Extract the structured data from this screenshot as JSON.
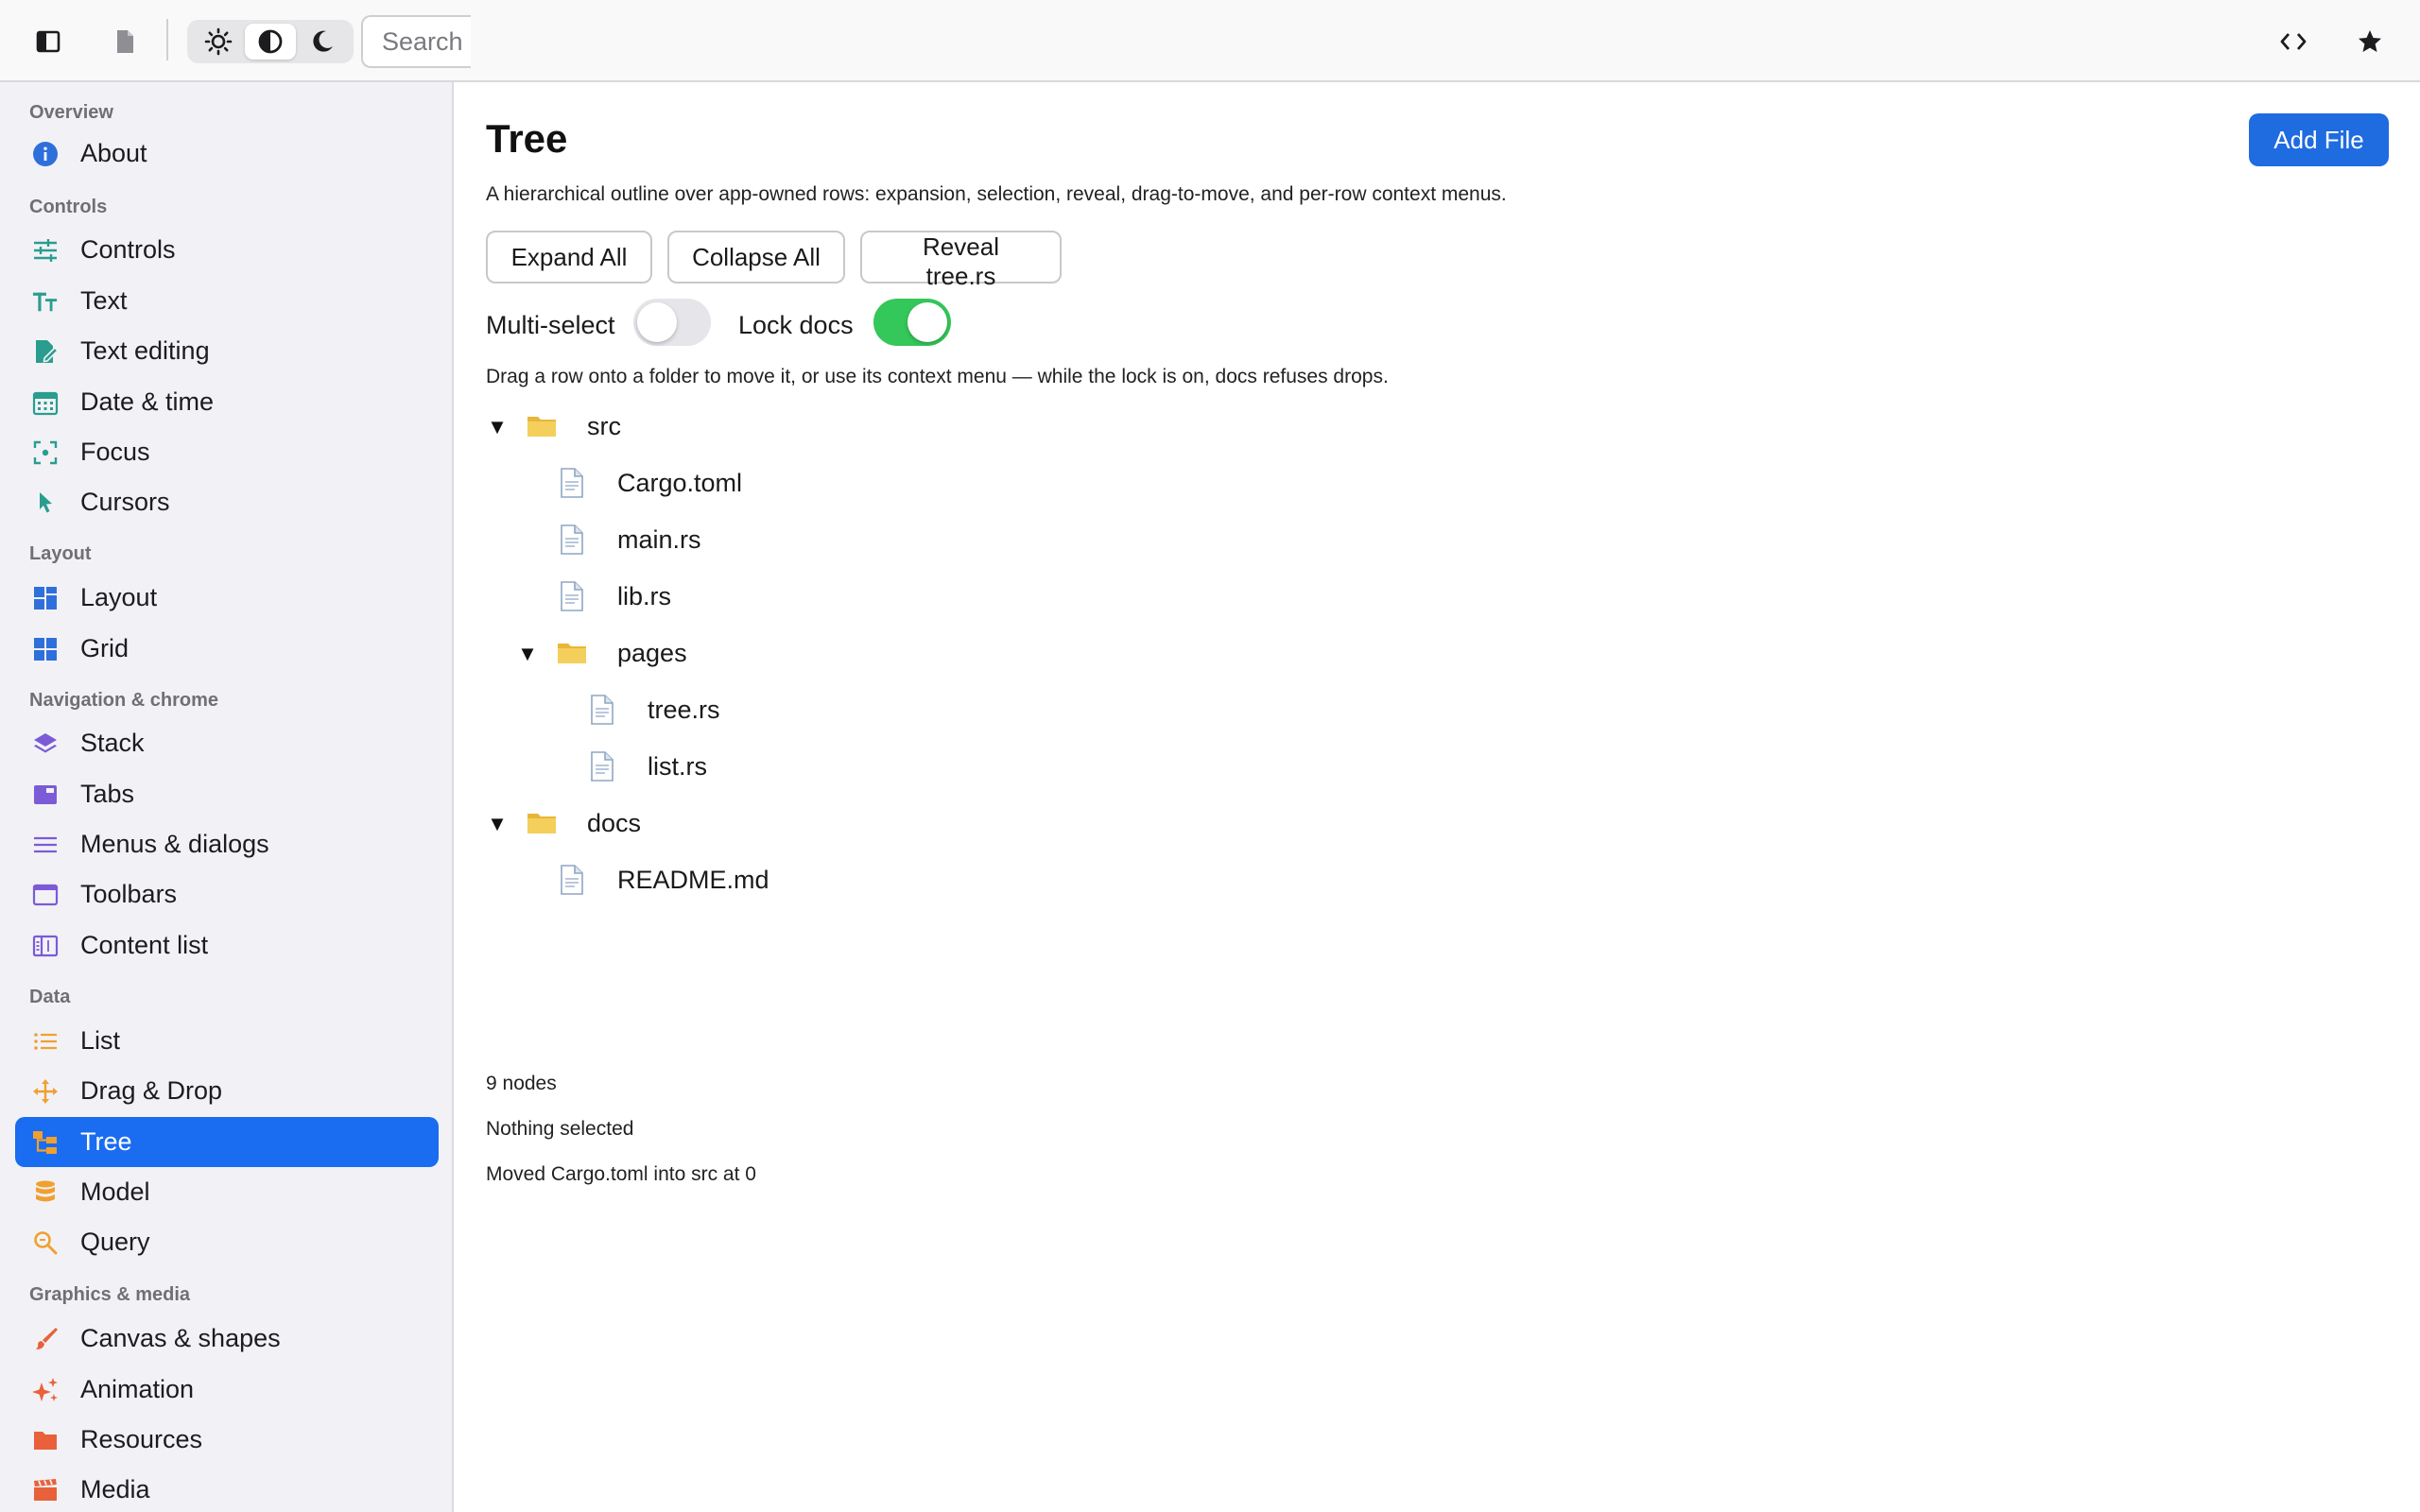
{
  "toolbar": {
    "search_placeholder": "Search",
    "icons": [
      "sidebar-toggle-icon",
      "document-icon",
      "sun-icon",
      "contrast-icon",
      "moon-icon",
      "code-icon",
      "star-icon"
    ],
    "active_theme": "contrast"
  },
  "sidebar": {
    "sections": [
      {
        "title": "Overview",
        "items": [
          {
            "label": "About",
            "icon": "info-icon",
            "color": "#2f6fdb"
          }
        ]
      },
      {
        "title": "Controls",
        "items": [
          {
            "label": "Controls",
            "icon": "sliders-icon",
            "color": "#2a9d8f"
          },
          {
            "label": "Text",
            "icon": "text-size-icon",
            "color": "#2a9d8f"
          },
          {
            "label": "Text editing",
            "icon": "edit-document-icon",
            "color": "#2a9d8f"
          },
          {
            "label": "Date & time",
            "icon": "calendar-icon",
            "color": "#2a9d8f"
          },
          {
            "label": "Focus",
            "icon": "focus-icon",
            "color": "#2a9d8f"
          },
          {
            "label": "Cursors",
            "icon": "cursor-icon",
            "color": "#2a9d8f"
          }
        ]
      },
      {
        "title": "Layout",
        "items": [
          {
            "label": "Layout",
            "icon": "layout-icon",
            "color": "#2f6fdb"
          },
          {
            "label": "Grid",
            "icon": "grid-icon",
            "color": "#2f6fdb"
          }
        ]
      },
      {
        "title": "Navigation & chrome",
        "items": [
          {
            "label": "Stack",
            "icon": "stack-icon",
            "color": "#7b5bd6"
          },
          {
            "label": "Tabs",
            "icon": "tabs-icon",
            "color": "#7b5bd6"
          },
          {
            "label": "Menus & dialogs",
            "icon": "menu-icon",
            "color": "#7b5bd6"
          },
          {
            "label": "Toolbars",
            "icon": "window-icon",
            "color": "#7b5bd6"
          },
          {
            "label": "Content list",
            "icon": "content-list-icon",
            "color": "#7b5bd6"
          }
        ]
      },
      {
        "title": "Data",
        "items": [
          {
            "label": "List",
            "icon": "list-icon",
            "color": "#f0a030"
          },
          {
            "label": "Drag & Drop",
            "icon": "move-icon",
            "color": "#f0a030"
          },
          {
            "label": "Tree",
            "icon": "tree-icon",
            "color": "#f0a030",
            "active": true
          },
          {
            "label": "Model",
            "icon": "database-icon",
            "color": "#f0a030"
          },
          {
            "label": "Query",
            "icon": "search-icon",
            "color": "#f0a030"
          }
        ]
      },
      {
        "title": "Graphics & media",
        "items": [
          {
            "label": "Canvas & shapes",
            "icon": "brush-icon",
            "color": "#e8613a"
          },
          {
            "label": "Animation",
            "icon": "sparkle-icon",
            "color": "#e8613a"
          },
          {
            "label": "Resources",
            "icon": "folder-icon",
            "color": "#e8613a"
          },
          {
            "label": "Media",
            "icon": "clapper-icon",
            "color": "#e8613a"
          }
        ]
      }
    ],
    "active_color": "#1a6cf0"
  },
  "main": {
    "title": "Tree",
    "add_button": "Add File",
    "description": "A hierarchical outline over app-owned rows: expansion, selection, reveal, drag-to-move, and per-row context menus.",
    "buttons": {
      "expand_all": "Expand All",
      "collapse_all": "Collapse All",
      "reveal": "Reveal tree.rs"
    },
    "toggles": {
      "multi_select": {
        "label": "Multi-select",
        "on": false
      },
      "lock_docs": {
        "label": "Lock docs",
        "on": true
      }
    },
    "hint": "Drag a row onto a folder to move it, or use its context menu — while the lock is on, docs refuses drops.",
    "tree": [
      {
        "label": "src",
        "type": "folder",
        "depth": 0,
        "expanded": true,
        "chevron": "▼"
      },
      {
        "label": "Cargo.toml",
        "type": "file",
        "depth": 1
      },
      {
        "label": "main.rs",
        "type": "file",
        "depth": 1
      },
      {
        "label": "lib.rs",
        "type": "file",
        "depth": 1
      },
      {
        "label": "pages",
        "type": "folder",
        "depth": 1,
        "expanded": true,
        "chevron": "▼"
      },
      {
        "label": "tree.rs",
        "type": "file",
        "depth": 2
      },
      {
        "label": "list.rs",
        "type": "file",
        "depth": 2
      },
      {
        "label": "docs",
        "type": "folder",
        "depth": 0,
        "expanded": true,
        "chevron": "▼"
      },
      {
        "label": "README.md",
        "type": "file",
        "depth": 1
      }
    ],
    "status": {
      "nodes": "9 nodes",
      "selection": "Nothing selected",
      "last_action": "Moved Cargo.toml into src at 0"
    }
  }
}
